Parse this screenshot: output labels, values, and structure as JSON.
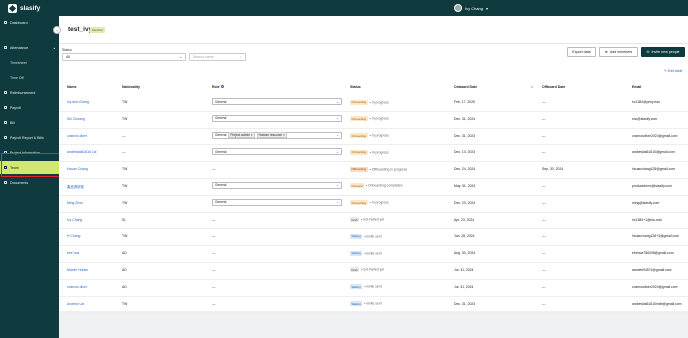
{
  "app": {
    "name": "slasify"
  },
  "user": {
    "name": "Ivy Chang"
  },
  "sidebar": {
    "items": [
      {
        "label": "Dashboard"
      },
      {
        "label": "Attendance"
      },
      {
        "label": "Timesheet"
      },
      {
        "label": "Time Off"
      },
      {
        "label": "Reimbursement"
      },
      {
        "label": "Payroll"
      },
      {
        "label": "Bill"
      },
      {
        "label": "Payroll Report & Bills"
      },
      {
        "label": "Project information"
      },
      {
        "label": "Team"
      },
      {
        "label": "Documents"
      }
    ]
  },
  "page": {
    "title": "test_ivy",
    "badge": "Member"
  },
  "filters": {
    "status_label": "Status",
    "status_value": "All",
    "search_placeholder": "Search name"
  },
  "actions": {
    "export": "Export data",
    "add": "Add members",
    "invite": "Invite new people",
    "edit_table": "Edit table"
  },
  "columns": {
    "name": "Name",
    "nationality": "Nationality",
    "role": "Role",
    "status": "Status",
    "onboard": "Onboard Date",
    "offboard": "Offboard Date",
    "email": "Email"
  },
  "rows": [
    {
      "name": "Ivy-test Chang",
      "nat": "TW",
      "role": [
        "General"
      ],
      "status_badge": "Onboarding",
      "status_text": "• In progress",
      "badge_class": "b-onb",
      "onboard": "Feb. 17, 2025",
      "offboard": "—",
      "email": "hc1384@privy.edu"
    },
    {
      "name": "Shi Chuang",
      "nat": "TW",
      "role": [
        "General"
      ],
      "status_badge": "Onboarding",
      "status_text": "• In progress",
      "badge_class": "b-onb",
      "onboard": "Dec. 31, 2024",
      "offboard": "—",
      "email": "shc@slasify.com"
    },
    {
      "name": "cosmos diver",
      "nat": "—",
      "role": [
        "General",
        "Project admin",
        "Human resource"
      ],
      "status_badge": "Onboarding",
      "status_text": "• In progress",
      "badge_class": "b-onb",
      "onboard": "Dec. 31, 2024",
      "offboard": "—",
      "email": "cosmosdiver2024@gmail.com"
    },
    {
      "name": "andrewlai61616 Lai",
      "nat": "—",
      "role": [
        "General"
      ],
      "status_badge": "Onboarding",
      "status_text": "• In progress",
      "badge_class": "b-onb",
      "onboard": "Dec. 13, 2024",
      "offboard": "—",
      "email": "andrewlai61616@gmail.com"
    },
    {
      "name": "Hsuan Chang",
      "nat": "TW",
      "role": [],
      "status_badge": "Offboarding",
      "status_text": "• Offboarding in progress",
      "badge_class": "b-off",
      "onboard": "Dec. 24, 2024",
      "offboard": "Sep. 30, 2024",
      "email": "hsuanchang128@gmail.com"
    },
    {
      "name": "產品測試帳",
      "nat": "TW",
      "role": [
        "General"
      ],
      "status_badge": "Onboard",
      "status_text": "• Onboarding completed",
      "badge_class": "b-onb",
      "onboard": "May. 31, 2024",
      "offboard": "—",
      "email": "productdemo@slasify.com"
    },
    {
      "name": "Ming Zhou",
      "nat": "TW",
      "role": [
        "General"
      ],
      "status_badge": "Onboarding",
      "status_text": "• In progress",
      "badge_class": "b-onb",
      "onboard": "Dec. 23, 2024",
      "offboard": "—",
      "email": "ming@slasify.com"
    },
    {
      "name": "Ivy Chang",
      "nat": "ID",
      "role": [],
      "status_badge": "Draft",
      "status_text": "• not invited yet",
      "badge_class": "b-draft",
      "onboard": "Apr. 23, 2024",
      "offboard": "—",
      "email": "hc1384+1@ntu.edu"
    },
    {
      "name": "H Chang",
      "nat": "TW",
      "role": [],
      "status_badge": "Waiting",
      "status_text": "• invite sent",
      "badge_class": "b-wait",
      "onboard": "Jun. 28, 2024",
      "offboard": "—",
      "email": "hsuanchang128+3@gmail.com"
    },
    {
      "name": "eee hoa",
      "nat": "AD",
      "role": [],
      "status_badge": "Waiting",
      "status_text": "• invite sent",
      "badge_class": "b-wait",
      "onboard": "Aug. 30, 2024",
      "offboard": "—",
      "email": "eeehoa786008@gmail.com"
    },
    {
      "name": "Marvin Hunter",
      "nat": "AD",
      "role": [],
      "status_badge": "Draft",
      "status_text": "• not invited yet",
      "badge_class": "b-draft",
      "onboard": "Jul. 31, 2024",
      "offboard": "—",
      "email": "aamele94574@gmail.com"
    },
    {
      "name": "cosmos diver",
      "nat": "AD",
      "role": [],
      "status_badge": "Waiting",
      "status_text": "• invite sent",
      "badge_class": "b-wait",
      "onboard": "Jul. 31, 2024",
      "offboard": "—",
      "email": "cosmosdiver2024@gmail.com"
    },
    {
      "name": "Andrew Lai",
      "nat": "TW",
      "role": [],
      "status_badge": "Waiting",
      "status_text": "• invite sent",
      "badge_class": "b-wait",
      "onboard": "Dec. 31, 2024",
      "offboard": "—",
      "email": "andrewlai61616mdb@gmail.com"
    }
  ]
}
